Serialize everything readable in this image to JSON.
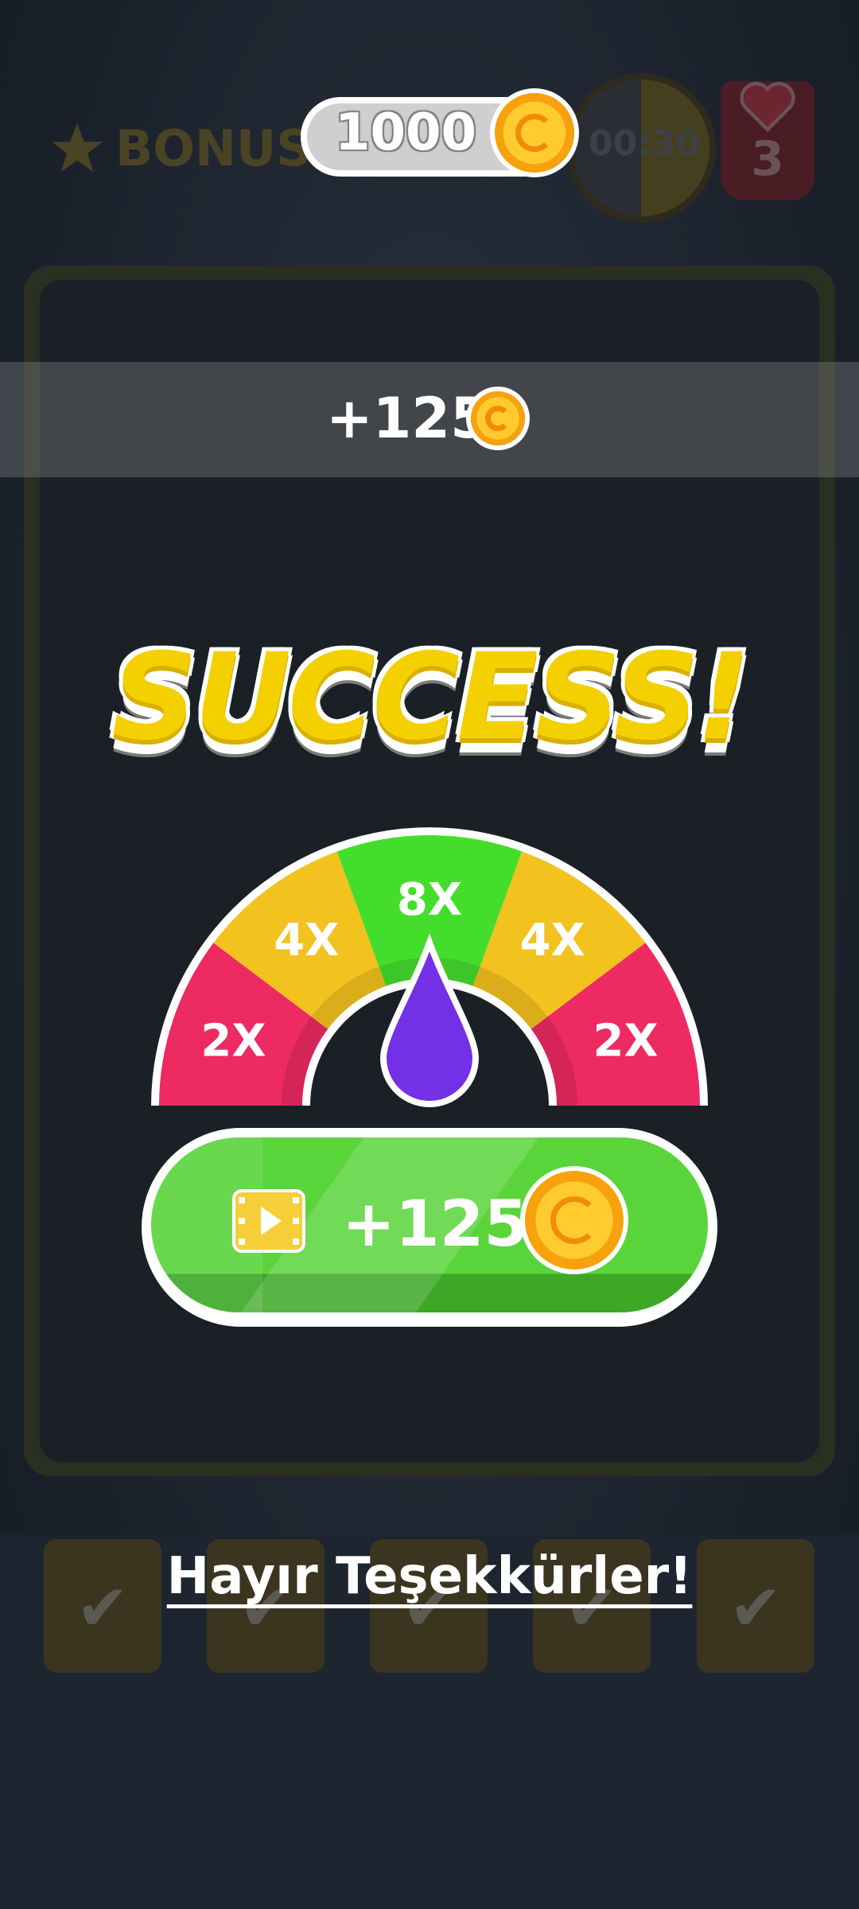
{
  "header": {
    "bonus_label": "BONUS",
    "coin_balance": "1000",
    "timer": "00:30",
    "lives": "3"
  },
  "reward_banner": {
    "amount": "+125"
  },
  "result": {
    "title": "SUCCESS!"
  },
  "multiplier_meter": {
    "segments": [
      "2X",
      "4X",
      "8X",
      "4X",
      "2X"
    ],
    "segment_colors": [
      "#ee2a62",
      "#f2c21e",
      "#45dd2c",
      "#f2c21e",
      "#ee2a62"
    ],
    "needle_color": "#7330e6",
    "pointed_segment": "8X"
  },
  "claim_button": {
    "amount": "+125",
    "icon": "video-play-icon"
  },
  "decline_link": {
    "label": "Hayır Teşekkürler!"
  },
  "colors": {
    "coin": "#ffc21c",
    "button_green": "#4fd233",
    "title_yellow": "#f4d000"
  }
}
